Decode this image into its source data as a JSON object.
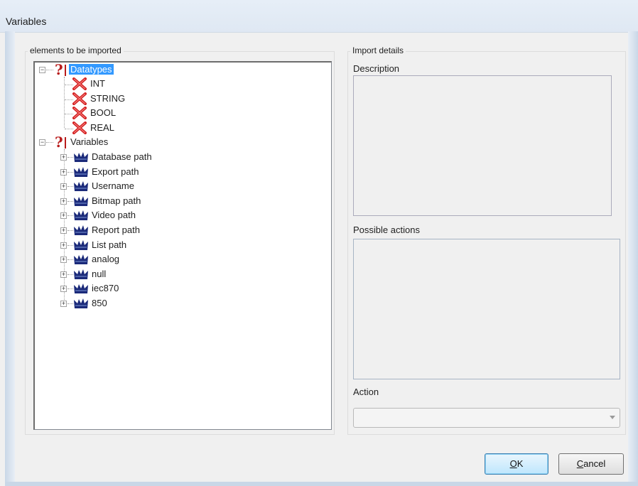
{
  "window": {
    "title": "Variables"
  },
  "elements_group": {
    "label": "elements to be imported",
    "tree": {
      "datatypes": {
        "label": "Datatypes",
        "children": [
          "INT",
          "STRING",
          "BOOL",
          "REAL"
        ]
      },
      "variables": {
        "label": "Variables",
        "children": [
          "Database path",
          "Export path",
          "Username",
          "Bitmap path",
          "Video path",
          "Report path",
          "List path",
          "analog",
          "null",
          "iec870",
          "850"
        ]
      }
    }
  },
  "import_details": {
    "label": "Import details",
    "description_label": "Description",
    "possible_actions_label": "Possible actions",
    "action_label": "Action",
    "action_value": ""
  },
  "buttons": {
    "ok_mnemonic": "O",
    "ok_rest": "K",
    "cancel_mnemonic": "C",
    "cancel_rest": "ancel"
  },
  "colors": {
    "selection": "#3399ff",
    "error_x": "#d21e1e",
    "question_mark": "#b81b1b",
    "variable_icon": "#1b2a7a"
  },
  "icons": {
    "datatypes_group": "question-mark-icon",
    "datatype_item": "red-x-error-icon",
    "variable_item": "variable-icon"
  }
}
